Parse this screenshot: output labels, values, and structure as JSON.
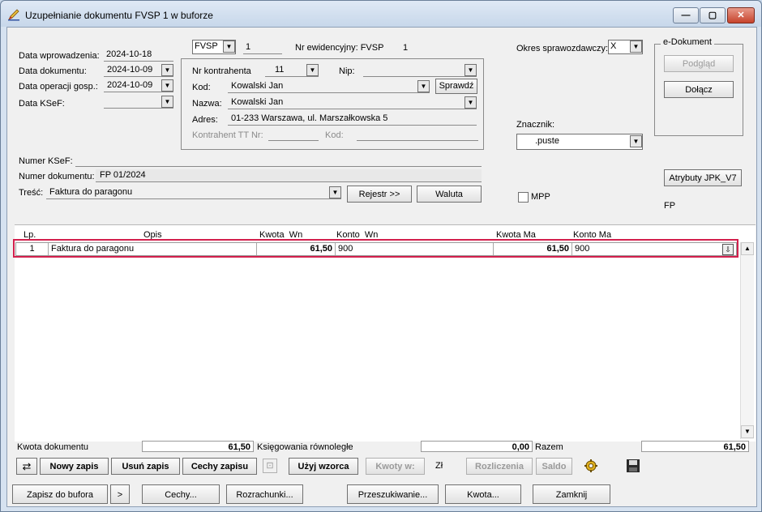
{
  "window": {
    "title": "Uzupełnianie dokumentu FVSP 1 w buforze",
    "minimize": "—",
    "maximize": "▢",
    "close": "✕"
  },
  "header": {
    "data_wprowadzenia_label": "Data wprowadzenia:",
    "data_wprowadzenia": "2024-10-18",
    "data_dokumentu_label": "Data dokumentu:",
    "data_dokumentu": "2024-10-09",
    "data_operacji_label": "Data operacji gosp.:",
    "data_operacji": "2024-10-09",
    "data_ksef_label": "Data KSeF:",
    "data_ksef": "",
    "doc_type": "FVSP",
    "doc_number": "1",
    "nr_ewid_label": "Nr ewidencyjny: FVSP",
    "nr_ewid_value": "1",
    "okres_label": "Okres sprawozdawczy:",
    "okres_value": "X",
    "znacznik_label": "Znacznik:",
    "znacznik_value": ".puste",
    "mpp_label": "MPP",
    "fp_label": "FP"
  },
  "contractor": {
    "nr_kontrahenta_label": "Nr kontrahenta",
    "nr_kontrahenta": "11",
    "nip_label": "Nip:",
    "nip": "",
    "kod_label": "Kod:",
    "kod": "Kowalski Jan",
    "sprawdz": "Sprawdź",
    "nazwa_label": "Nazwa:",
    "nazwa": "Kowalski Jan",
    "adres_label": "Adres:",
    "adres": "01-233 Warszawa, ul. Marszałkowska 5",
    "tt_label": "Kontrahent TT Nr:",
    "tt_kod_label": "Kod:"
  },
  "edokument": {
    "legend": "e-Dokument",
    "podglad": "Podgląd",
    "dolacz": "Dołącz",
    "atrybuty": "Atrybuty JPK_V7"
  },
  "numbers": {
    "ksef_label": "Numer KSeF:",
    "ksef": "",
    "numer_dok_label": "Numer dokumentu:",
    "numer_dok": "FP 01/2024",
    "tresc_label": "Treść:",
    "tresc": "Faktura do paragonu",
    "rejestr": "Rejestr >>",
    "waluta": "Waluta"
  },
  "grid": {
    "columns": [
      "Lp.",
      "Opis",
      "Kwota  Wn",
      "Konto  Wn",
      "Kwota Ma",
      "Konto Ma"
    ],
    "rows": [
      {
        "lp": "1",
        "opis": "Faktura do paragonu",
        "kwota_wn": "61,50",
        "konto_wn": "900",
        "kwota_ma": "61,50",
        "konto_ma": "900"
      }
    ]
  },
  "summary": {
    "kwota_dok_label": "Kwota dokumentu",
    "kwota_dok": "61,50",
    "ksieg_label": "Księgowania równoległe",
    "ksieg": "0,00",
    "razem_label": "Razem",
    "razem": "61,50"
  },
  "toolbar": {
    "nowy_zapis": "Nowy zapis",
    "usun_zapis": "Usuń zapis",
    "cechy_zapisu": "Cechy zapisu",
    "uzyj_wzorca": "Użyj wzorca",
    "kwoty_w": "Kwoty w:",
    "zl": "Zł",
    "rozliczenia": "Rozliczenia",
    "saldo": "Saldo"
  },
  "bottom": {
    "zapisz": "Zapisz do bufora",
    "more": ">",
    "cechy": "Cechy...",
    "rozrachunki": "Rozrachunki...",
    "przeszukiwanie": "Przeszukiwanie...",
    "kwota": "Kwota...",
    "zamknij": "Zamknij"
  }
}
